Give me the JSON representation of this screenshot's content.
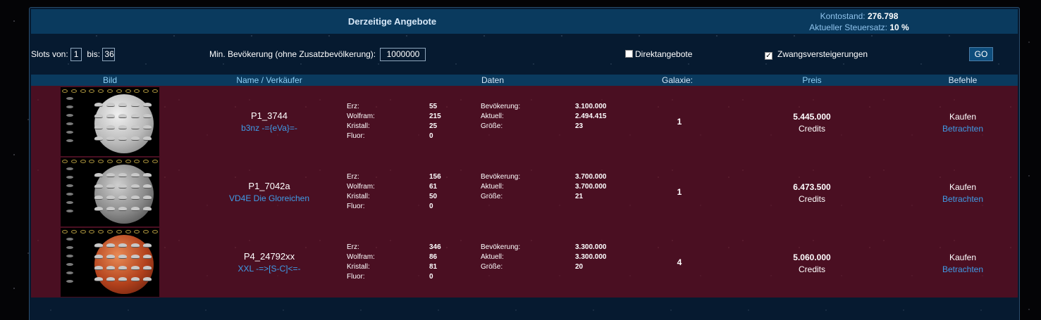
{
  "header": {
    "title": "Derzeitige Angebote",
    "balance_label": "Kontostand:",
    "balance_value": "276.798",
    "tax_label": "Aktueller Steuersatz:",
    "tax_value": "10 %"
  },
  "filters": {
    "slots_from_label": "Slots von:",
    "slots_from_value": "1",
    "slots_to_label": "bis:",
    "slots_to_value": "36",
    "min_pop_label": "Min. Bevökerung (ohne Zusatzbevölkerung):",
    "min_pop_value": "1000000",
    "direct_label": "Direktangebote",
    "direct_checked": false,
    "forced_label": "Zwangsversteigerungen",
    "forced_checked": true,
    "go_label": "GO"
  },
  "table": {
    "columns": [
      "Bild",
      "Name / Verkäufer",
      "Daten",
      "Galaxie:",
      "Preis",
      "Befehle"
    ],
    "rows": [
      {
        "name": "P1_3744",
        "seller": "b3nz -={eVa}=-",
        "erz_label": "Erz:",
        "erz": "55",
        "wolfram_label": "Wolfram:",
        "wolfram": "215",
        "kristall_label": "Kristall:",
        "kristall": "25",
        "fluor_label": "Fluor:",
        "fluor": "0",
        "pop_label": "Bevökerung:",
        "pop": "3.100.000",
        "current_label": "Aktuell:",
        "current": "2.494.415",
        "size_label": "Größe:",
        "size": "23",
        "galaxy": "1",
        "price": "5.445.000",
        "currency": "Credits",
        "buy": "Kaufen",
        "view": "Betrachten",
        "planet_color": "#b9b9b9"
      },
      {
        "name": "P1_7042a",
        "seller": "VD4E Die Gloreichen",
        "erz_label": "Erz:",
        "erz": "156",
        "wolfram_label": "Wolfram:",
        "wolfram": "61",
        "kristall_label": "Kristall:",
        "kristall": "50",
        "fluor_label": "Fluor:",
        "fluor": "0",
        "pop_label": "Bevökerung:",
        "pop": "3.700.000",
        "current_label": "Aktuell:",
        "current": "3.700.000",
        "size_label": "Größe:",
        "size": "21",
        "galaxy": "1",
        "price": "6.473.500",
        "currency": "Credits",
        "buy": "Kaufen",
        "view": "Betrachten",
        "planet_color": "#888888"
      },
      {
        "name": "P4_24792xx",
        "seller": "XXL -=>[S-C]<=-",
        "erz_label": "Erz:",
        "erz": "346",
        "wolfram_label": "Wolfram:",
        "wolfram": "86",
        "kristall_label": "Kristall:",
        "kristall": "81",
        "fluor_label": "Fluor:",
        "fluor": "0",
        "pop_label": "Bevökerung:",
        "pop": "3.300.000",
        "current_label": "Aktuell:",
        "current": "3.300.000",
        "size_label": "Größe:",
        "size": "20",
        "galaxy": "4",
        "price": "5.060.000",
        "currency": "Credits",
        "buy": "Kaufen",
        "view": "Betrachten",
        "planet_color": "#b2411c"
      }
    ]
  },
  "colors": {
    "header_bg": "#0a3a5e",
    "row_bg": "#4a0f22",
    "link": "#3f9be6",
    "accent": "#8fd0f5"
  }
}
